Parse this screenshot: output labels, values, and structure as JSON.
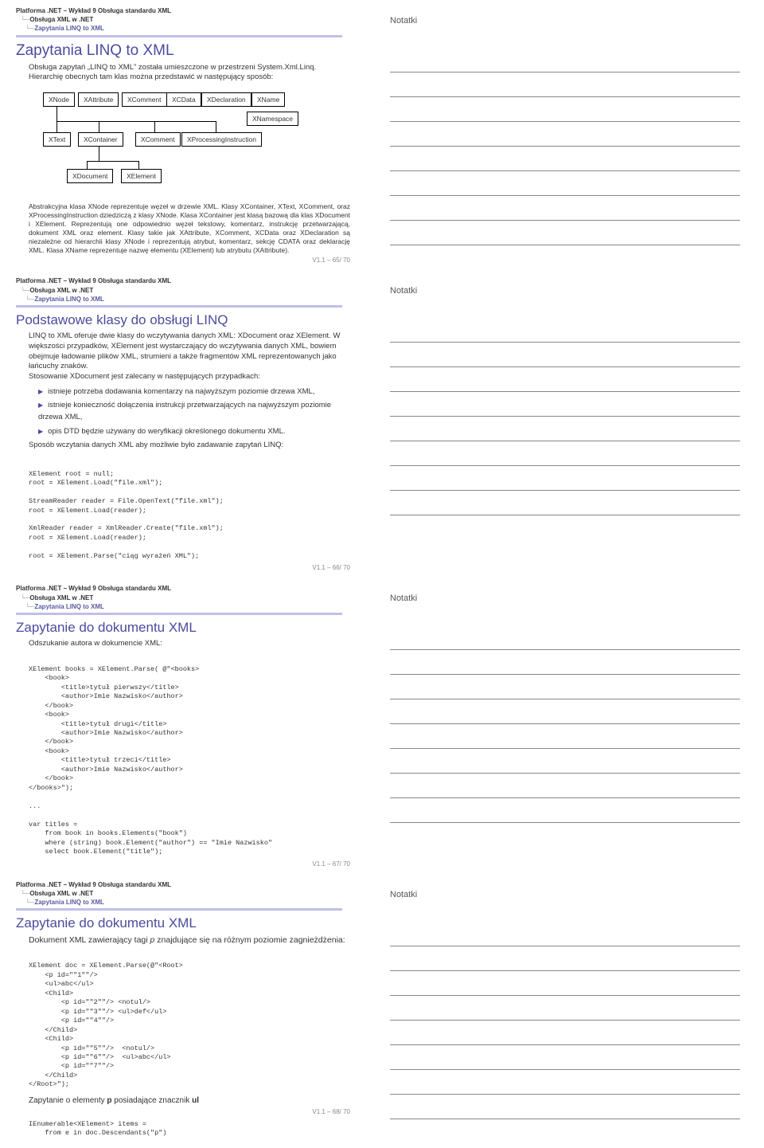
{
  "common": {
    "breadcrumb1": "Platforma .NET – Wykład 9  Obsługa standardu XML",
    "breadcrumb2": "Obsługa XML w .NET",
    "breadcrumb3": "Zapytania LINQ to XML",
    "notes_title": "Notatki"
  },
  "slides": [
    {
      "title": "Zapytania LINQ to XML",
      "intro": "Obsługa zapytań „LINQ to XML” została umieszczone w przestrzeni System.Xml.Linq. Hierarchię obecnych tam klas można przedstawić w następujący sposób:",
      "diagram": {
        "row1": [
          "XNode",
          "XAttribute",
          "XComment",
          "XCData",
          "XDeclaration",
          "XName"
        ],
        "row15": [
          "XNamespace"
        ],
        "row2": [
          "XText",
          "XContainer",
          "XComment",
          "XProcessingInstruction"
        ],
        "row3": [
          "XDocument",
          "XElement"
        ]
      },
      "desc": "Abstrakcyjna klasa XNode reprezentuje węzeł w drzewie XML. Klasy XContainer, XText, XComment, oraz XProcessingInstruction dziedziczą z klasy XNode. Klasa XContainer jest klasą bazową dla klas XDocument i XElement. Reprezentują one odpowiednio węzeł tekstowy, komentarz, instrukcję przetwarzającą, dokument XML oraz element. Klasy takie jak XAttribute, XComment, XCData oraz XDeclaration są niezależne od hierarchii klasy XNode i reprezentują atrybut, komentarz, sekcję CDATA oraz deklarację XML. Klasa XName reprezentuje nazwę elementu (XElement) lub atrybutu (XAttribute).",
      "footer": "V1.1 – 65/ 70"
    },
    {
      "title": "Podstawowe klasy do obsługi LINQ",
      "intro": "LINQ to XML oferuje dwie klasy do wczytywania danych XML: XDocument oraz XElement. W większości przypadków, XElement jest wystarczający do wczytywania danych XML, bowiem obejmuje ładowanie plików XML, strumieni a także fragmentów XML reprezentowanych jako łańcuchy znaków.\nStosowanie XDocument jest zalecany w następujących przypadkach:",
      "bullets": [
        "istnieje potrzeba dodawania komentarzy na najwyższym poziomie drzewa XML,",
        "istnieje konieczność dołączenia instrukcji przetwarzających na najwyższym poziomie drzewa XML,",
        "opis DTD będzie używany do weryfikacji określonego dokumentu XML."
      ],
      "post": "Sposób wczytania danych XML aby możliwie było zadawanie zapytań LINQ:",
      "code": "XElement root = null;\nroot = XElement.Load(\"file.xml\");\n\nStreamReader reader = File.OpenText(\"file.xml\");\nroot = XElement.Load(reader);\n\nXmlReader reader = XmlReader.Create(\"file.xml\");\nroot = XElement.Load(reader);\n\nroot = XElement.Parse(\"ciąg wyrażeń XML\");",
      "footer": "V1.1 – 66/ 70"
    },
    {
      "title": "Zapytanie do dokumentu XML",
      "intro": "Odszukanie autora w dokumencie XML:",
      "code": "XElement books = XElement.Parse( @\"<books>\n    <book>\n        <title>tytuł pierwszy</title>\n        <author>Imie Nazwisko</author>\n    </book>\n    <book>\n        <title>tytuł drugi</title>\n        <author>Imie Nazwisko</author>\n    </book>\n    <book>\n        <title>tytuł trzeci</title>\n        <author>Imie Nazwisko</author>\n    </book>\n</books>\");\n\n...\n\nvar titles =\n    from book in books.Elements(\"book\")\n    where (string) book.Element(\"author\") == \"Imie Nazwisko\"\n    select book.Element(\"title\");",
      "footer": "V1.1 – 67/ 70"
    },
    {
      "title": "Zapytanie do dokumentu XML",
      "intro_html": "Dokument XML zawierający tagi <i>p</i> znajdujące się na różnym poziomie zagnieżdżenia:",
      "code": "XElement doc = XElement.Parse(@\"<Root>\n    <p id=\"\"1\"\"/>\n    <ul>abc</ul>\n    <Child>\n        <p id=\"\"2\"\"/> <notul/>\n        <p id=\"\"3\"\"/> <ul>def</ul>\n        <p id=\"\"4\"\"/>\n    </Child>\n    <Child>\n        <p id=\"\"5\"\"/>  <notul/>\n        <p id=\"\"6\"\"/>  <ul>abc</ul>\n        <p id=\"\"7\"\"/>\n    </Child>\n</Root>\");",
      "query_text_html": "Zapytanie o elementy <b>p</b> posiadające znacznik <b>ul</b>",
      "code2": "IEnumerable<XElement> items =\n    from e in doc.Descendants(\"p\")",
      "footer": "V1.1 – 68/ 70"
    }
  ]
}
